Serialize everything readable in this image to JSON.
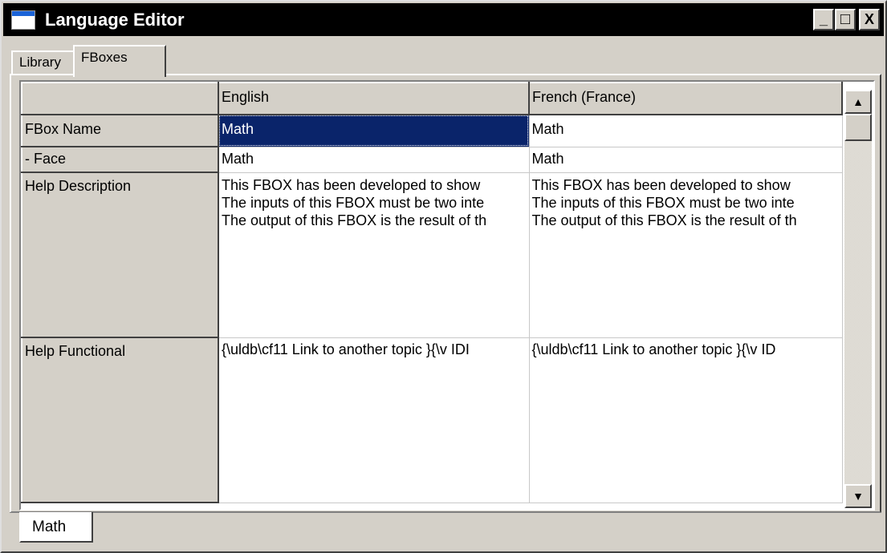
{
  "window": {
    "title": "Language Editor",
    "controls": {
      "minimize": "_",
      "maximize": "□",
      "close": "X"
    }
  },
  "tabs": [
    {
      "label": "Library",
      "active": false
    },
    {
      "label": "FBoxes",
      "active": true
    }
  ],
  "grid": {
    "columns": [
      "English",
      "French (France)"
    ],
    "rows": [
      {
        "label": "FBox Name",
        "values": [
          "Math",
          "Math"
        ]
      },
      {
        "label": "- Face",
        "values": [
          "Math",
          "Math"
        ]
      },
      {
        "label": "Help Description",
        "values": [
          [
            "This FBOX has been developed to show",
            "The inputs of this FBOX must be two inte",
            "The output of this FBOX is the result of th"
          ],
          [
            "This FBOX has been developed to show",
            "The inputs of this FBOX must be two inte",
            "The output of this FBOX is the result of th"
          ]
        ]
      },
      {
        "label": "Help Functional",
        "values": [
          "{\\uldb\\cf11 Link to another topic }{\\v IDI",
          "{\\uldb\\cf11 Link to another topic }{\\v ID"
        ]
      }
    ],
    "selected_cell": "FBox Name / English"
  },
  "scrollbar": {
    "up": "▲",
    "down": "▼"
  },
  "bottom_tabs": [
    {
      "label": "Math",
      "active": true
    }
  ],
  "colors": {
    "selection": "#0a246a",
    "face": "#d4d0c8",
    "titlebar": "#000000"
  }
}
